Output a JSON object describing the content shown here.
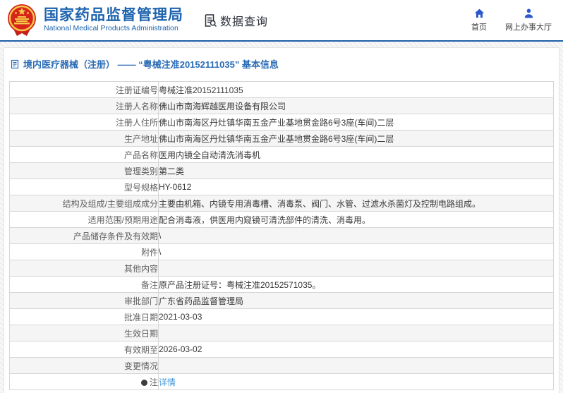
{
  "header": {
    "logo": {
      "cn_title": "国家药品监督管理局",
      "en_title": "National Medical Products Administration"
    },
    "data_query_label": "数据查询",
    "nav": [
      {
        "icon": "home-icon",
        "label": "首页"
      },
      {
        "icon": "user-icon",
        "label": "网上办事大厅"
      }
    ]
  },
  "breadcrumb": {
    "text": "境内医疗器械（注册） —— “粤械注准20152111035” 基本信息"
  },
  "table": {
    "rows": [
      {
        "label": "注册证编号",
        "value": "粤械注准20152111035"
      },
      {
        "label": "注册人名称",
        "value": "佛山市南海辉越医用设备有限公司"
      },
      {
        "label": "注册人住所",
        "value": "佛山市南海区丹灶镇华南五金产业基地贯金路6号3座(车间)二层"
      },
      {
        "label": "生产地址",
        "value": "佛山市南海区丹灶镇华南五金产业基地贯金路6号3座(车间)二层"
      },
      {
        "label": "产品名称",
        "value": "医用内镜全自动清洗消毒机"
      },
      {
        "label": "管理类别",
        "value": "第二类"
      },
      {
        "label": "型号规格",
        "value": "HY-0612"
      },
      {
        "label": "结构及组成/主要组成成分",
        "value": "主要由机箱、内镜专用消毒槽、消毒泵、阀门、水管、过滤水杀菌灯及控制电路组成。"
      },
      {
        "label": "适用范围/预期用途",
        "value": "配合消毒液，供医用内窥镜可清洗部件的清洗、消毒用。"
      },
      {
        "label": "产品储存条件及有效期",
        "value": "\\"
      },
      {
        "label": "附件",
        "value": "\\"
      },
      {
        "label": "其他内容",
        "value": ""
      },
      {
        "label": "备注",
        "value": "原产品注册证号：粤械注准20152571035。"
      },
      {
        "label": "审批部门",
        "value": "广东省药品监督管理局"
      },
      {
        "label": "批准日期",
        "value": "2021-03-03"
      },
      {
        "label": "生效日期",
        "value": ""
      },
      {
        "label": "有效期至",
        "value": "2026-03-02"
      },
      {
        "label": "变更情况",
        "value": ""
      },
      {
        "label": "注",
        "value": "详情",
        "link": true,
        "icon": "note-icon"
      }
    ]
  },
  "colors": {
    "accent_blue": "#1e63ae",
    "header_border_blue": "#1c5fa8",
    "nav_icon_blue": "#2b57cc",
    "link_blue": "#4596d9",
    "emblem_red": "#d6261c",
    "emblem_gold": "#f7c948",
    "alt_row": "#f5f5f6"
  }
}
